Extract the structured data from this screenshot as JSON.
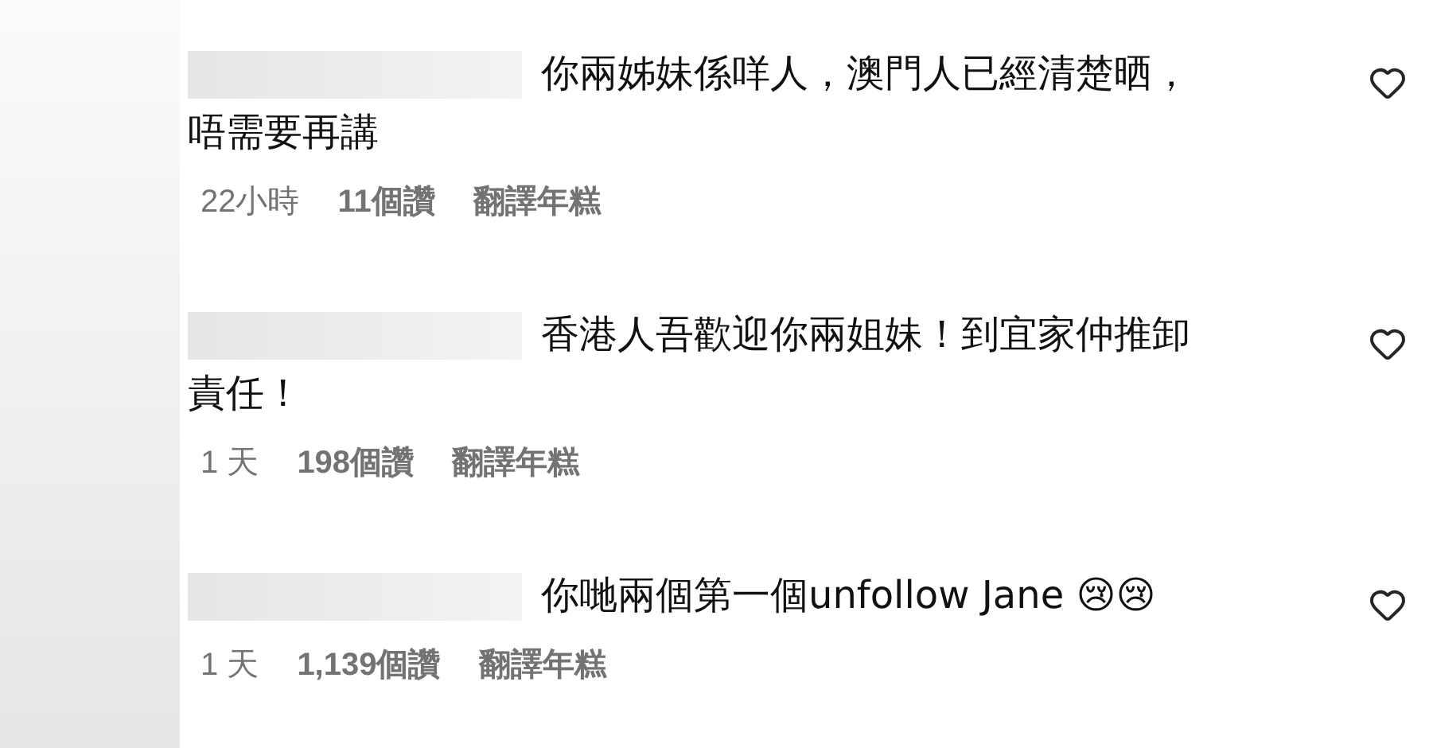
{
  "comments": [
    {
      "lines": [
        "你兩姊妹係咩人，澳門人已經清楚晒，",
        "唔需要再講"
      ],
      "time": "22小時",
      "likes": "11個讚",
      "translate": "翻譯年糕",
      "liked": false
    },
    {
      "lines": [
        "香港人吾歡迎你兩姐妹！到宜家仲推卸",
        "責任！"
      ],
      "time": "1 天",
      "likes": "198個讚",
      "translate": "翻譯年糕",
      "liked": false
    },
    {
      "lines": [
        "你哋兩個第一個unfollow Jane 😢😢"
      ],
      "time": "1 天",
      "likes": "1,139個讚",
      "translate": "翻譯年糕",
      "liked": false
    }
  ]
}
